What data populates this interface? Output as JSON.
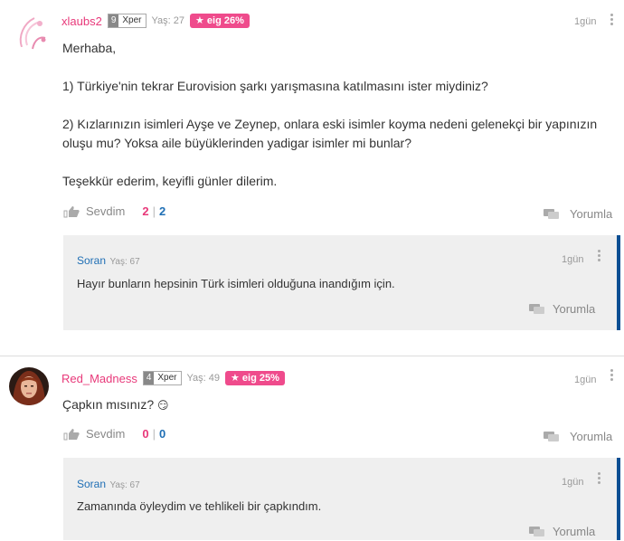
{
  "posts": [
    {
      "username": "xlaubs2",
      "level": "9",
      "rank": "Xper",
      "age": "Yaş: 27",
      "eig": "★ eig 26%",
      "time": "1gün",
      "paragraphs": [
        "Merhaba,",
        "1) Türkiye'nin tekrar Eurovision şarkı yarışmasına katılmasını ister miydiniz?",
        "2) Kızlarınızın isimleri Ayşe ve Zeynep, onlara eski isimler koyma nedeni gelenekçi bir yapınızın oluşu mu? Yoksa aile büyüklerinden yadigar isimler mi bunlar?",
        "Teşekkür ederim, keyifli günler dilerim."
      ],
      "like_label": "Sevdim",
      "likes_pink": "2",
      "likes_blue": "2",
      "comment_label": "Yorumla",
      "reply": {
        "name": "Soran",
        "age": "Yaş: 67",
        "time": "1gün",
        "text": "Hayır bunların hepsinin Türk isimleri olduğuna inandığım için.",
        "comment_label": "Yorumla"
      }
    },
    {
      "username": "Red_Madness",
      "level": "4",
      "rank": "Xper",
      "age": "Yaş: 49",
      "eig": "★ eig 25%",
      "time": "1gün",
      "text": "Çapkın mısınız?",
      "emoji": "😏",
      "like_label": "Sevdim",
      "likes_pink": "0",
      "likes_blue": "0",
      "comment_label": "Yorumla",
      "reply": {
        "name": "Soran",
        "age": "Yaş: 67",
        "time": "1gün",
        "text": "Zamanında öyleydim ve tehlikeli bir çapkındım.",
        "comment_label": "Yorumla"
      }
    }
  ],
  "colors": {
    "accent_pink": "#e8397a",
    "accent_blue": "#1f6fb5",
    "reply_border": "#0a4f93",
    "reply_bg": "#efefef"
  }
}
